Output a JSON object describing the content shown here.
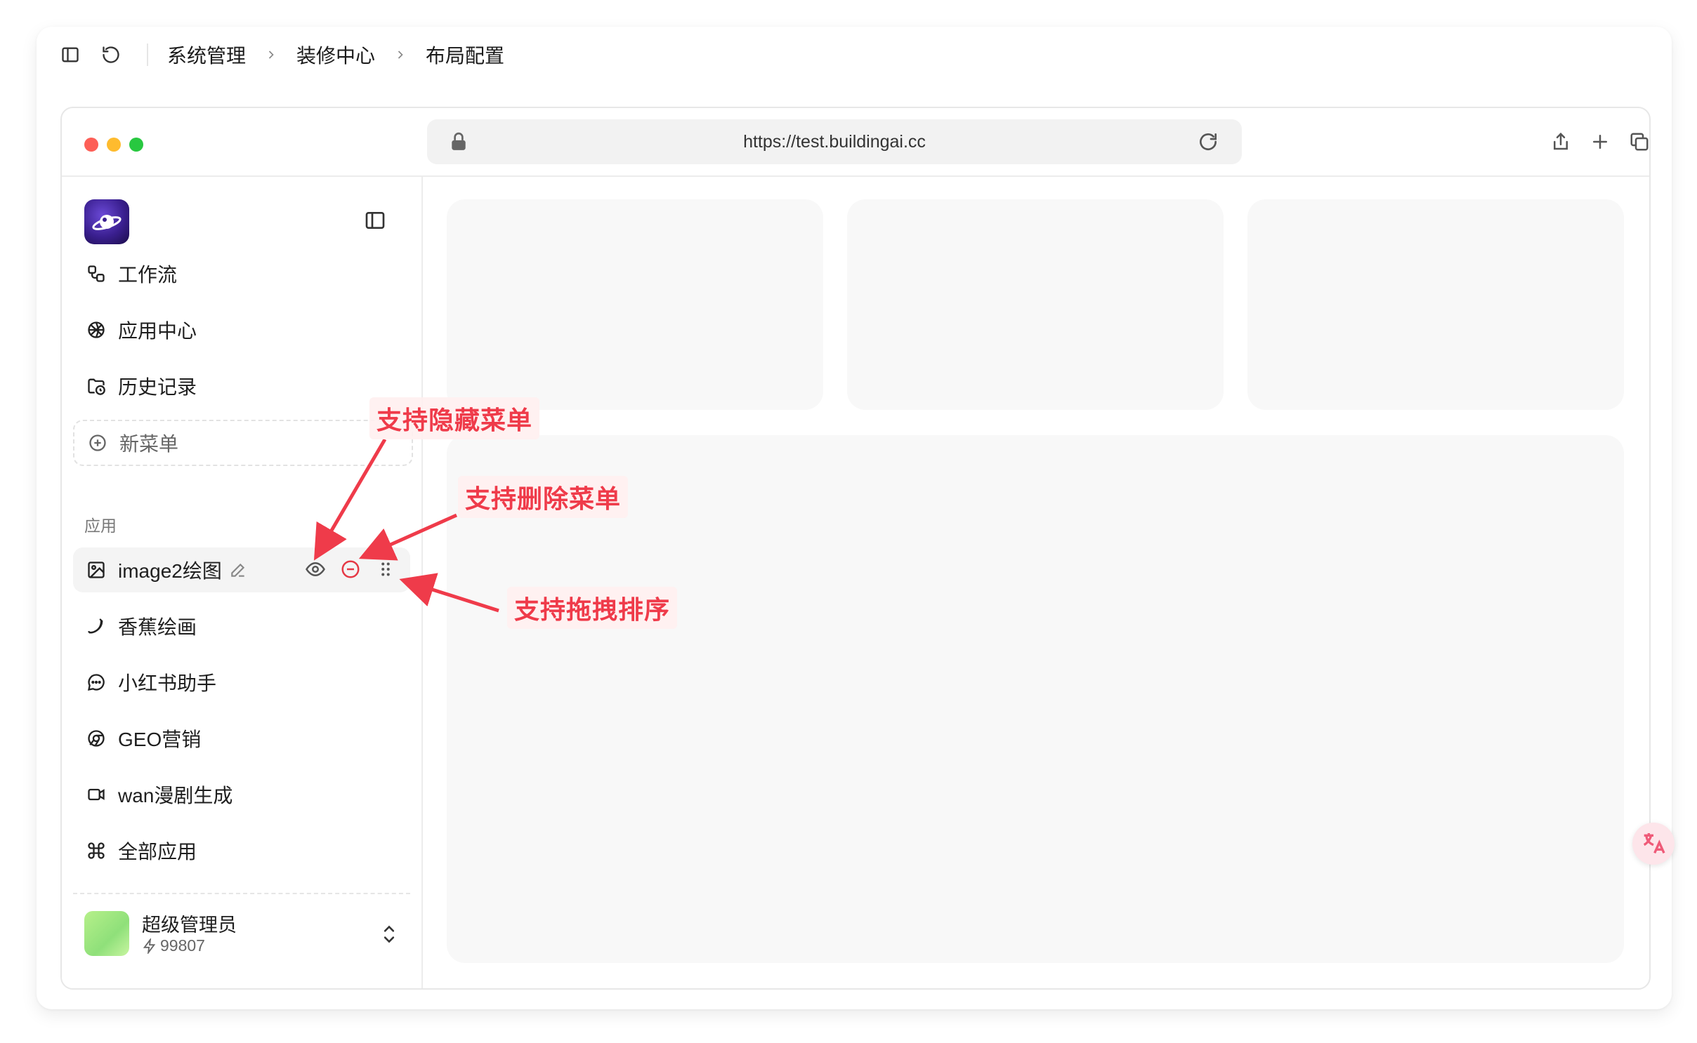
{
  "breadcrumb": {
    "items": [
      "系统管理",
      "装修中心",
      "布局配置"
    ],
    "separator": ">"
  },
  "browser": {
    "url": "https://test.buildingai.cc",
    "dot_colors": [
      "#fd5f57",
      "#febb2e",
      "#28c840"
    ]
  },
  "sidebar": {
    "top_items": [
      {
        "label": "工作流",
        "icon": "workflow-icon"
      },
      {
        "label": "应用中心",
        "icon": "app-center-icon"
      },
      {
        "label": "历史记录",
        "icon": "history-folder-icon"
      }
    ],
    "new_menu_label": "新菜单",
    "section_label": "应用",
    "app_items": [
      {
        "label": "image2绘图",
        "icon": "image-icon"
      },
      {
        "label": "香蕉绘画",
        "icon": "banana-icon"
      },
      {
        "label": "小红书助手",
        "icon": "chat-bubble-icon"
      },
      {
        "label": "GEO营销",
        "icon": "chrome-icon"
      },
      {
        "label": "wan漫剧生成",
        "icon": "video-camera-icon"
      },
      {
        "label": "全部应用",
        "icon": "command-icon"
      }
    ]
  },
  "user": {
    "name": "超级管理员",
    "credits": "99807"
  },
  "annotations": {
    "hide_menu": "支持隐藏菜单",
    "delete_menu": "支持删除菜单",
    "drag_sort": "支持拖拽排序"
  },
  "colors": {
    "accent_red": "#ef3b4a",
    "placeholder": "#f8f8f8"
  }
}
